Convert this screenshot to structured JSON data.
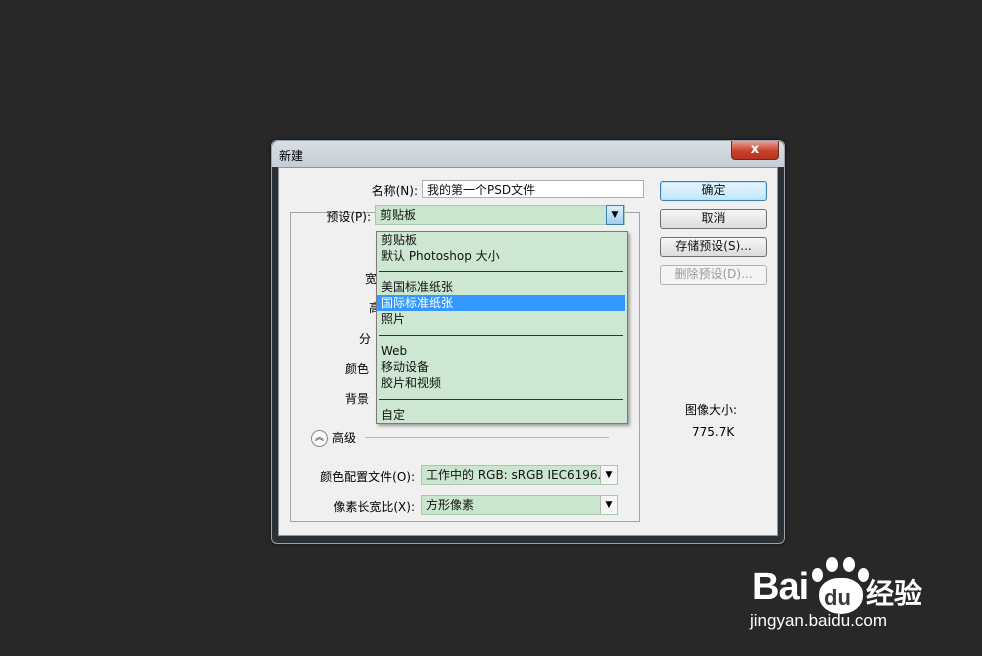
{
  "dialog": {
    "title": "新建",
    "close_glyph": "x",
    "name_label": "名称(N):",
    "name_value": "我的第一个PSD文件",
    "preset_label": "预设(P):",
    "preset_value": "剪贴板",
    "preset_arrow": "▼",
    "hidden_labels": [
      "宽",
      "高",
      "分",
      "颜色",
      "背景"
    ],
    "advanced_icon": "︽",
    "advanced_label": "高级",
    "color_profile_label": "颜色配置文件(O):",
    "color_profile_value": "工作中的 RGB: sRGB IEC6196...",
    "pixel_aspect_label": "像素长宽比(X):",
    "pixel_aspect_value": "方形像素",
    "combo_arrow": "▼",
    "image_size_label": "图像大小:",
    "image_size_value": "775.7K"
  },
  "buttons": {
    "ok": "确定",
    "cancel": "取消",
    "save_preset": "存储预设(S)...",
    "delete_preset": "删除预设(D)..."
  },
  "preset_menu": {
    "items": [
      "剪贴板",
      "默认 Photoshop 大小",
      "美国标准纸张",
      "国际标准纸张",
      "照片",
      "Web",
      "移动设备",
      "胶片和视频",
      "自定"
    ],
    "selected": "国际标准纸张"
  },
  "watermark": {
    "brand_left": "Bai",
    "brand_right": "du",
    "brand_cn": "经验",
    "url": "jingyan.baidu.com"
  },
  "colors": {
    "background": "#282828",
    "combo_fill": "#cbe6cf",
    "selection": "#3399ff",
    "default_button": "#bee6fd"
  }
}
